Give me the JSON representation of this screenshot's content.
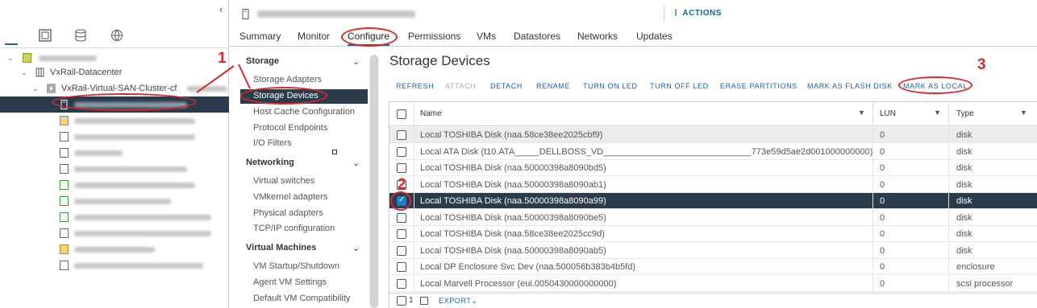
{
  "nav": {
    "tree": [
      {
        "label": "VxRail-Datacenter"
      },
      {
        "label": "VxRail-Virtual-SAN-Cluster-cf"
      },
      {
        "label": ""
      }
    ]
  },
  "header": {
    "actions_label": "ACTIONS"
  },
  "tabs": [
    "Summary",
    "Monitor",
    "Configure",
    "Permissions",
    "VMs",
    "Datastores",
    "Networks",
    "Updates"
  ],
  "config_menu": {
    "storage": {
      "title": "Storage",
      "items": [
        "Storage Adapters",
        "Storage Devices",
        "Host Cache Configuration",
        "Protocol Endpoints",
        "I/O Filters"
      ]
    },
    "networking": {
      "title": "Networking",
      "items": [
        "Virtual switches",
        "VMkernel adapters",
        "Physical adapters",
        "TCP/IP configuration"
      ]
    },
    "virtual_machines": {
      "title": "Virtual Machines",
      "items": [
        "VM Startup/Shutdown",
        "Agent VM Settings",
        "Default VM Compatibility"
      ]
    }
  },
  "content": {
    "title": "Storage Devices",
    "toolbar": [
      "REFRESH",
      "ATTACH",
      "DETACH",
      "RENAME",
      "TURN ON LED",
      "TURN OFF LED",
      "ERASE PARTITIONS",
      "MARK AS FLASH DISK",
      "MARK AS LOCAL"
    ],
    "columns": [
      "Name",
      "LUN",
      "Type"
    ],
    "rows": [
      {
        "name": "Local TOSHIBA Disk (naa.58ce38ee2025cbf9)",
        "lun": "0",
        "type": "disk"
      },
      {
        "name": "Local ATA Disk (t10.ATA_____DELLBOSS_VD______________________________773e59d5ae2d001000000000)",
        "lun": "0",
        "type": "disk"
      },
      {
        "name": "Local TOSHIBA Disk (naa.50000398a8090bd5)",
        "lun": "0",
        "type": "disk"
      },
      {
        "name": "Local TOSHIBA Disk (naa.50000398a8090ab1)",
        "lun": "0",
        "type": "disk"
      },
      {
        "name": "Local TOSHIBA Disk (naa.50000398a8090a99)",
        "lun": "0",
        "type": "disk"
      },
      {
        "name": "Local TOSHIBA Disk (naa.50000398a8090be5)",
        "lun": "0",
        "type": "disk"
      },
      {
        "name": "Local TOSHIBA Disk (naa.58ce38ee2025cc9d)",
        "lun": "0",
        "type": "disk"
      },
      {
        "name": "Local TOSHIBA Disk (naa.50000398a8090ab5)",
        "lun": "0",
        "type": "disk"
      },
      {
        "name": "Local DP Enclosure Svc Dev (naa.500056b383b4b5fd)",
        "lun": "0",
        "type": "enclosure"
      },
      {
        "name": "Local Marvell Processor (eui.0050430000000000)",
        "lun": "0",
        "type": "scsi processor"
      }
    ],
    "footer": {
      "selected_count": "1",
      "export_label": "EXPORT"
    }
  },
  "annotations": [
    "1",
    "2",
    "3"
  ],
  "colors": {
    "accent": "#1d5fa7",
    "selected_row": "#2a3c4c",
    "annotation": "#d9282a"
  }
}
